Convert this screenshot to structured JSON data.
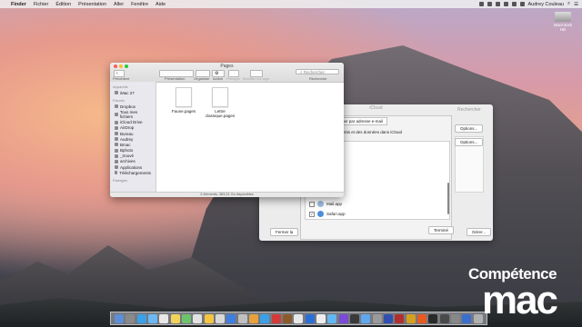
{
  "menubar": {
    "items": [
      "Finder",
      "Fichier",
      "Édition",
      "Présentation",
      "Aller",
      "Fenêtre",
      "Aide"
    ],
    "user": "Audrey Couleau"
  },
  "desktop": {
    "disk_label": "Macintosh HD"
  },
  "prefs_window": {
    "title": "iCloud",
    "search_placeholder": "Rechercher",
    "tab_partial": "ents",
    "tab_selected": "Me rechercher par adresse e-mail",
    "description": "ant des documents et des données dans iCloud",
    "options_button": "Options...",
    "apps": [
      {
        "name": "Mail.app",
        "checked": false
      },
      {
        "name": "Safari.app",
        "checked": true
      }
    ],
    "done_button": "Terminé",
    "close_button": "Fermer la",
    "manage_button": "Gérer..."
  },
  "finder": {
    "title": "Pages",
    "toolbar": {
      "back_label": "Précédent",
      "view_label": "Présentation",
      "arrange_label": "Organiser",
      "action_label": "Action",
      "share_label": "Partager",
      "tags_label": "Modifier les tags",
      "search_label": "Recherche",
      "search_placeholder": "Rechercher"
    },
    "sidebar": {
      "devices_header": "Appareils",
      "devices": [
        "iMac 27"
      ],
      "favorites_header": "Favoris",
      "favorites": [
        "Dropbox",
        "Tous mes fichiers",
        "iCloud Drive",
        "AirDrop",
        "Bureau",
        "Audrey",
        "Bmac",
        "Bphoto",
        "_trouvé",
        "archives",
        "Applications",
        "Téléchargements"
      ],
      "shared_header": "Partagés"
    },
    "files": [
      {
        "name": "Faune.pages"
      },
      {
        "name": "Lettre classique.pages"
      }
    ],
    "status": "2 éléments, 383,51 Go disponibles"
  },
  "watermark": {
    "line1": "Compétence",
    "line2": "mac"
  },
  "dock": {
    "colors": [
      "#5c8fd6",
      "#8a8a8a",
      "#3aa0e8",
      "#6bb8f5",
      "#e8e8e8",
      "#f2d35a",
      "#6dc36d",
      "#e2e2e2",
      "#f5c542",
      "#d8d8d8",
      "#3d7ee0",
      "#c0c0c0",
      "#e8a23b",
      "#3aa0e8",
      "#d43a3a",
      "#8b5a2b",
      "#e8e8e8",
      "#2b6fd6",
      "#eeeeee",
      "#62b8f0",
      "#7b4ad6",
      "#3a3a3a",
      "#5fa8f0",
      "#9a9a9a",
      "#3050b0",
      "#b03030",
      "#d4a020",
      "#e85a20",
      "#2a2a2a",
      "#4a4a4a",
      "#888888",
      "#3a6fd0",
      "#b0b0b0"
    ]
  }
}
